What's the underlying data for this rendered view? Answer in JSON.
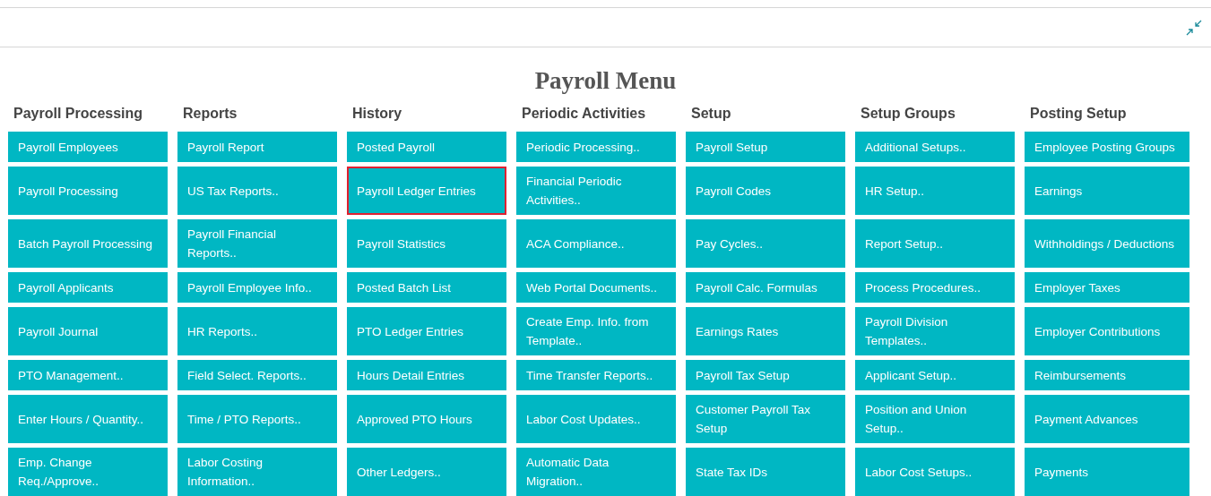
{
  "title": "Payroll Menu",
  "columns": [
    {
      "heading": "Payroll Processing",
      "items": [
        {
          "label": "Payroll Employees",
          "selected": false
        },
        {
          "label": "Payroll Processing",
          "selected": false
        },
        {
          "label": "Batch Payroll Processing",
          "selected": false
        },
        {
          "label": "Payroll Applicants",
          "selected": false
        },
        {
          "label": "Payroll Journal",
          "selected": false
        },
        {
          "label": "PTO Management..",
          "selected": false
        },
        {
          "label": "Enter Hours / Quantity..",
          "selected": false
        },
        {
          "label": "Emp. Change Req./Approve..",
          "selected": false
        }
      ]
    },
    {
      "heading": "Reports",
      "items": [
        {
          "label": "Payroll Report",
          "selected": false
        },
        {
          "label": "US Tax Reports..",
          "selected": false
        },
        {
          "label": "Payroll Financial Reports..",
          "selected": false
        },
        {
          "label": "Payroll Employee Info..",
          "selected": false
        },
        {
          "label": "HR Reports..",
          "selected": false
        },
        {
          "label": "Field Select. Reports..",
          "selected": false
        },
        {
          "label": "Time / PTO Reports..",
          "selected": false
        },
        {
          "label": "Labor Costing Information..",
          "selected": false
        }
      ]
    },
    {
      "heading": "History",
      "items": [
        {
          "label": "Posted Payroll",
          "selected": false
        },
        {
          "label": "Payroll Ledger Entries",
          "selected": true
        },
        {
          "label": "Payroll Statistics",
          "selected": false
        },
        {
          "label": "Posted Batch List",
          "selected": false
        },
        {
          "label": "PTO Ledger Entries",
          "selected": false
        },
        {
          "label": "Hours Detail Entries",
          "selected": false
        },
        {
          "label": "Approved PTO Hours",
          "selected": false
        },
        {
          "label": "Other Ledgers..",
          "selected": false
        }
      ]
    },
    {
      "heading": "Periodic Activities",
      "items": [
        {
          "label": "Periodic Processing..",
          "selected": false
        },
        {
          "label": "Financial Periodic Activities..",
          "selected": false
        },
        {
          "label": "ACA Compliance..",
          "selected": false
        },
        {
          "label": "Web Portal Documents..",
          "selected": false
        },
        {
          "label": "Create Emp. Info. from Template..",
          "selected": false
        },
        {
          "label": "Time Transfer Reports..",
          "selected": false
        },
        {
          "label": "Labor Cost Updates..",
          "selected": false
        },
        {
          "label": "Automatic Data Migration..",
          "selected": false
        }
      ]
    },
    {
      "heading": "Setup",
      "items": [
        {
          "label": "Payroll Setup",
          "selected": false
        },
        {
          "label": "Payroll Codes",
          "selected": false
        },
        {
          "label": "Pay Cycles..",
          "selected": false
        },
        {
          "label": "Payroll Calc. Formulas",
          "selected": false
        },
        {
          "label": "Earnings Rates",
          "selected": false
        },
        {
          "label": "Payroll Tax Setup",
          "selected": false
        },
        {
          "label": "Customer Payroll Tax Setup",
          "selected": false
        },
        {
          "label": "State Tax IDs",
          "selected": false
        }
      ]
    },
    {
      "heading": "Setup Groups",
      "items": [
        {
          "label": "Additional Setups..",
          "selected": false
        },
        {
          "label": "HR Setup..",
          "selected": false
        },
        {
          "label": "Report Setup..",
          "selected": false
        },
        {
          "label": "Process Procedures..",
          "selected": false
        },
        {
          "label": "Payroll Division Templates..",
          "selected": false
        },
        {
          "label": "Applicant Setup..",
          "selected": false
        },
        {
          "label": "Position and Union Setup..",
          "selected": false
        },
        {
          "label": "Labor Cost Setups..",
          "selected": false
        }
      ]
    },
    {
      "heading": "Posting Setup",
      "items": [
        {
          "label": "Employee Posting Groups",
          "selected": false
        },
        {
          "label": "Earnings",
          "selected": false
        },
        {
          "label": "Withholdings / Deductions",
          "selected": false
        },
        {
          "label": "Employer Taxes",
          "selected": false
        },
        {
          "label": "Employer Contributions",
          "selected": false
        },
        {
          "label": "Reimbursements",
          "selected": false
        },
        {
          "label": "Payment Advances",
          "selected": false
        },
        {
          "label": "Payments",
          "selected": false
        }
      ]
    }
  ]
}
